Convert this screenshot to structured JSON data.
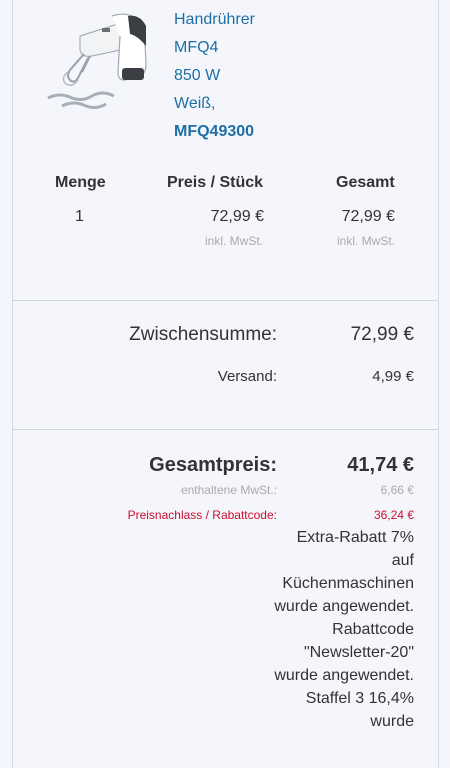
{
  "product": {
    "lines": [
      "Handrührer",
      "MFQ4",
      "850 W",
      "Weiß,"
    ],
    "sku": "MFQ49300",
    "image_icon": "hand-mixer-image"
  },
  "table": {
    "headers": {
      "qty": "Menge",
      "unit_price": "Preis / Stück",
      "total": "Gesamt"
    },
    "row": {
      "qty": "1",
      "unit_price": "72,99 €",
      "total": "72,99 €",
      "unit_note": "inkl. MwSt.",
      "total_note": "inkl. MwSt."
    }
  },
  "summary": {
    "subtotal_label": "Zwischensumme:",
    "subtotal_value": "72,99 €",
    "shipping_label": "Versand:",
    "shipping_value": "4,99 €"
  },
  "totals": {
    "grand_label": "Gesamtpreis:",
    "grand_value": "41,74 €",
    "vat_label": "enthaltene MwSt.:",
    "vat_value": "6,66 €",
    "discount_label": "Preisnachlass / Rabattcode:",
    "discount_value": "36,24 €",
    "discount_description": "Extra-Rabatt 7% auf Küchenmaschinen wurde angewendet. Rabattcode \"Newsletter-20\" wurde angewendet. Staffel 3 16,4% wurde"
  },
  "colors": {
    "link": "#1f6fa4",
    "discount": "#c8102e",
    "muted": "#aaaaaa"
  }
}
